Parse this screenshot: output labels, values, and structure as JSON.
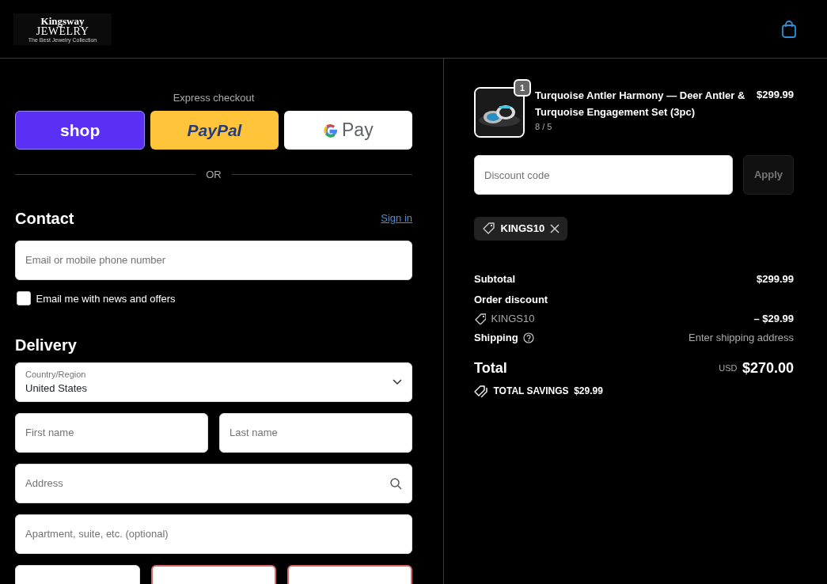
{
  "header": {
    "logo": {
      "name": "Kingsway",
      "word": "JEWELRY",
      "tagline": "The Best Jewelry Collection"
    }
  },
  "express": {
    "title": "Express checkout",
    "buttons": [
      {
        "kind": "shop",
        "label": "shop"
      },
      {
        "kind": "paypal",
        "label": "PayPal"
      },
      {
        "kind": "gpay",
        "label": "Pay"
      }
    ],
    "divider": "OR"
  },
  "contact": {
    "title": "Contact",
    "link": "Sign in",
    "field": {
      "placeholder": "Email or mobile phone number"
    },
    "newsletter": {
      "label": "Email me with news and offers",
      "checked": false
    }
  },
  "delivery": {
    "title": "Delivery",
    "country": {
      "label": "Country/Region",
      "value": "United States"
    },
    "rows": [
      [
        {
          "placeholder": "First name"
        },
        {
          "placeholder": "Last name"
        }
      ],
      [
        {
          "placeholder": "Address",
          "search": true
        }
      ],
      [
        {
          "placeholder": "Apartment, suite, etc. (optional)"
        }
      ],
      [
        {
          "invalid": false
        },
        {
          "invalid": true
        },
        {
          "invalid": true
        }
      ]
    ]
  },
  "summary": {
    "item": {
      "quantity": "1",
      "title": "Turquoise Antler Harmony — Deer Antler & Turquoise Engagement Set (3pc)",
      "variant": "8 / 5",
      "price": "$299.99"
    },
    "discount": {
      "placeholder": "Discount code",
      "button": "Apply",
      "applied": "KINGS10"
    },
    "lines": [
      {
        "kind": "plain",
        "label": "Subtotal",
        "value": "$299.99"
      },
      {
        "kind": "heading",
        "label": "Order discount"
      },
      {
        "kind": "code",
        "label": "KINGS10",
        "value": "– $29.99"
      },
      {
        "kind": "help",
        "label": "Shipping",
        "value": "Enter shipping address"
      }
    ],
    "total": {
      "label": "Total",
      "currency": "USD",
      "value": "$270.00"
    },
    "savings": {
      "label": "TOTAL SAVINGS",
      "value": "$29.99"
    }
  }
}
